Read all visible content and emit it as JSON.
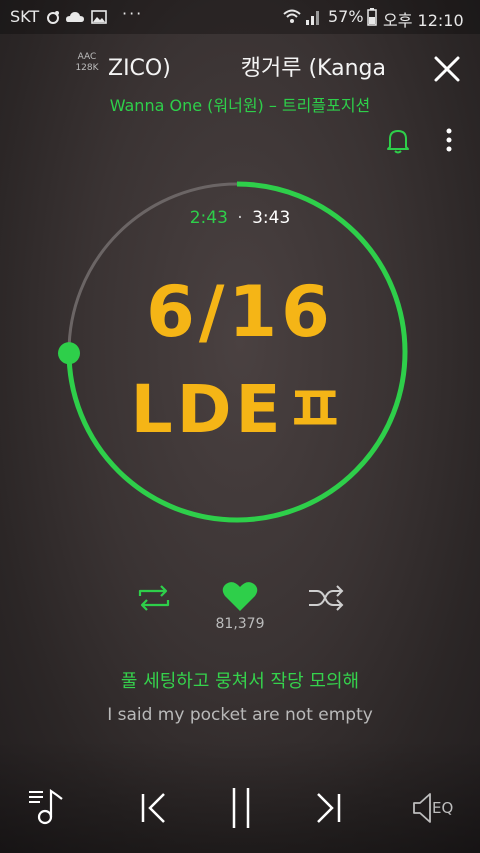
{
  "status_bar": {
    "carrier": "SKT",
    "battery": "57%",
    "time": "오후 12:10"
  },
  "header": {
    "codec_line1": "AAC",
    "codec_line2": "128K",
    "title_marquee": "ZICO)          캥거루 (Kanga",
    "artist_album": "Wanna One (워너원) – 트리플포지션"
  },
  "player": {
    "elapsed": "2:43",
    "separator": "·",
    "total": "3:43",
    "progress_fraction": 0.7489,
    "accent_color": "#2ecf4a"
  },
  "album_art": {
    "line1": "6/16",
    "line2": "LDEㅍ"
  },
  "actions": {
    "like_count": "81,379"
  },
  "lyrics": {
    "current": "풀 세팅하고 뭉쳐서 작당 모의해",
    "next": "I said my pocket are not empty"
  },
  "controls": {
    "eq_label": "EQ"
  }
}
